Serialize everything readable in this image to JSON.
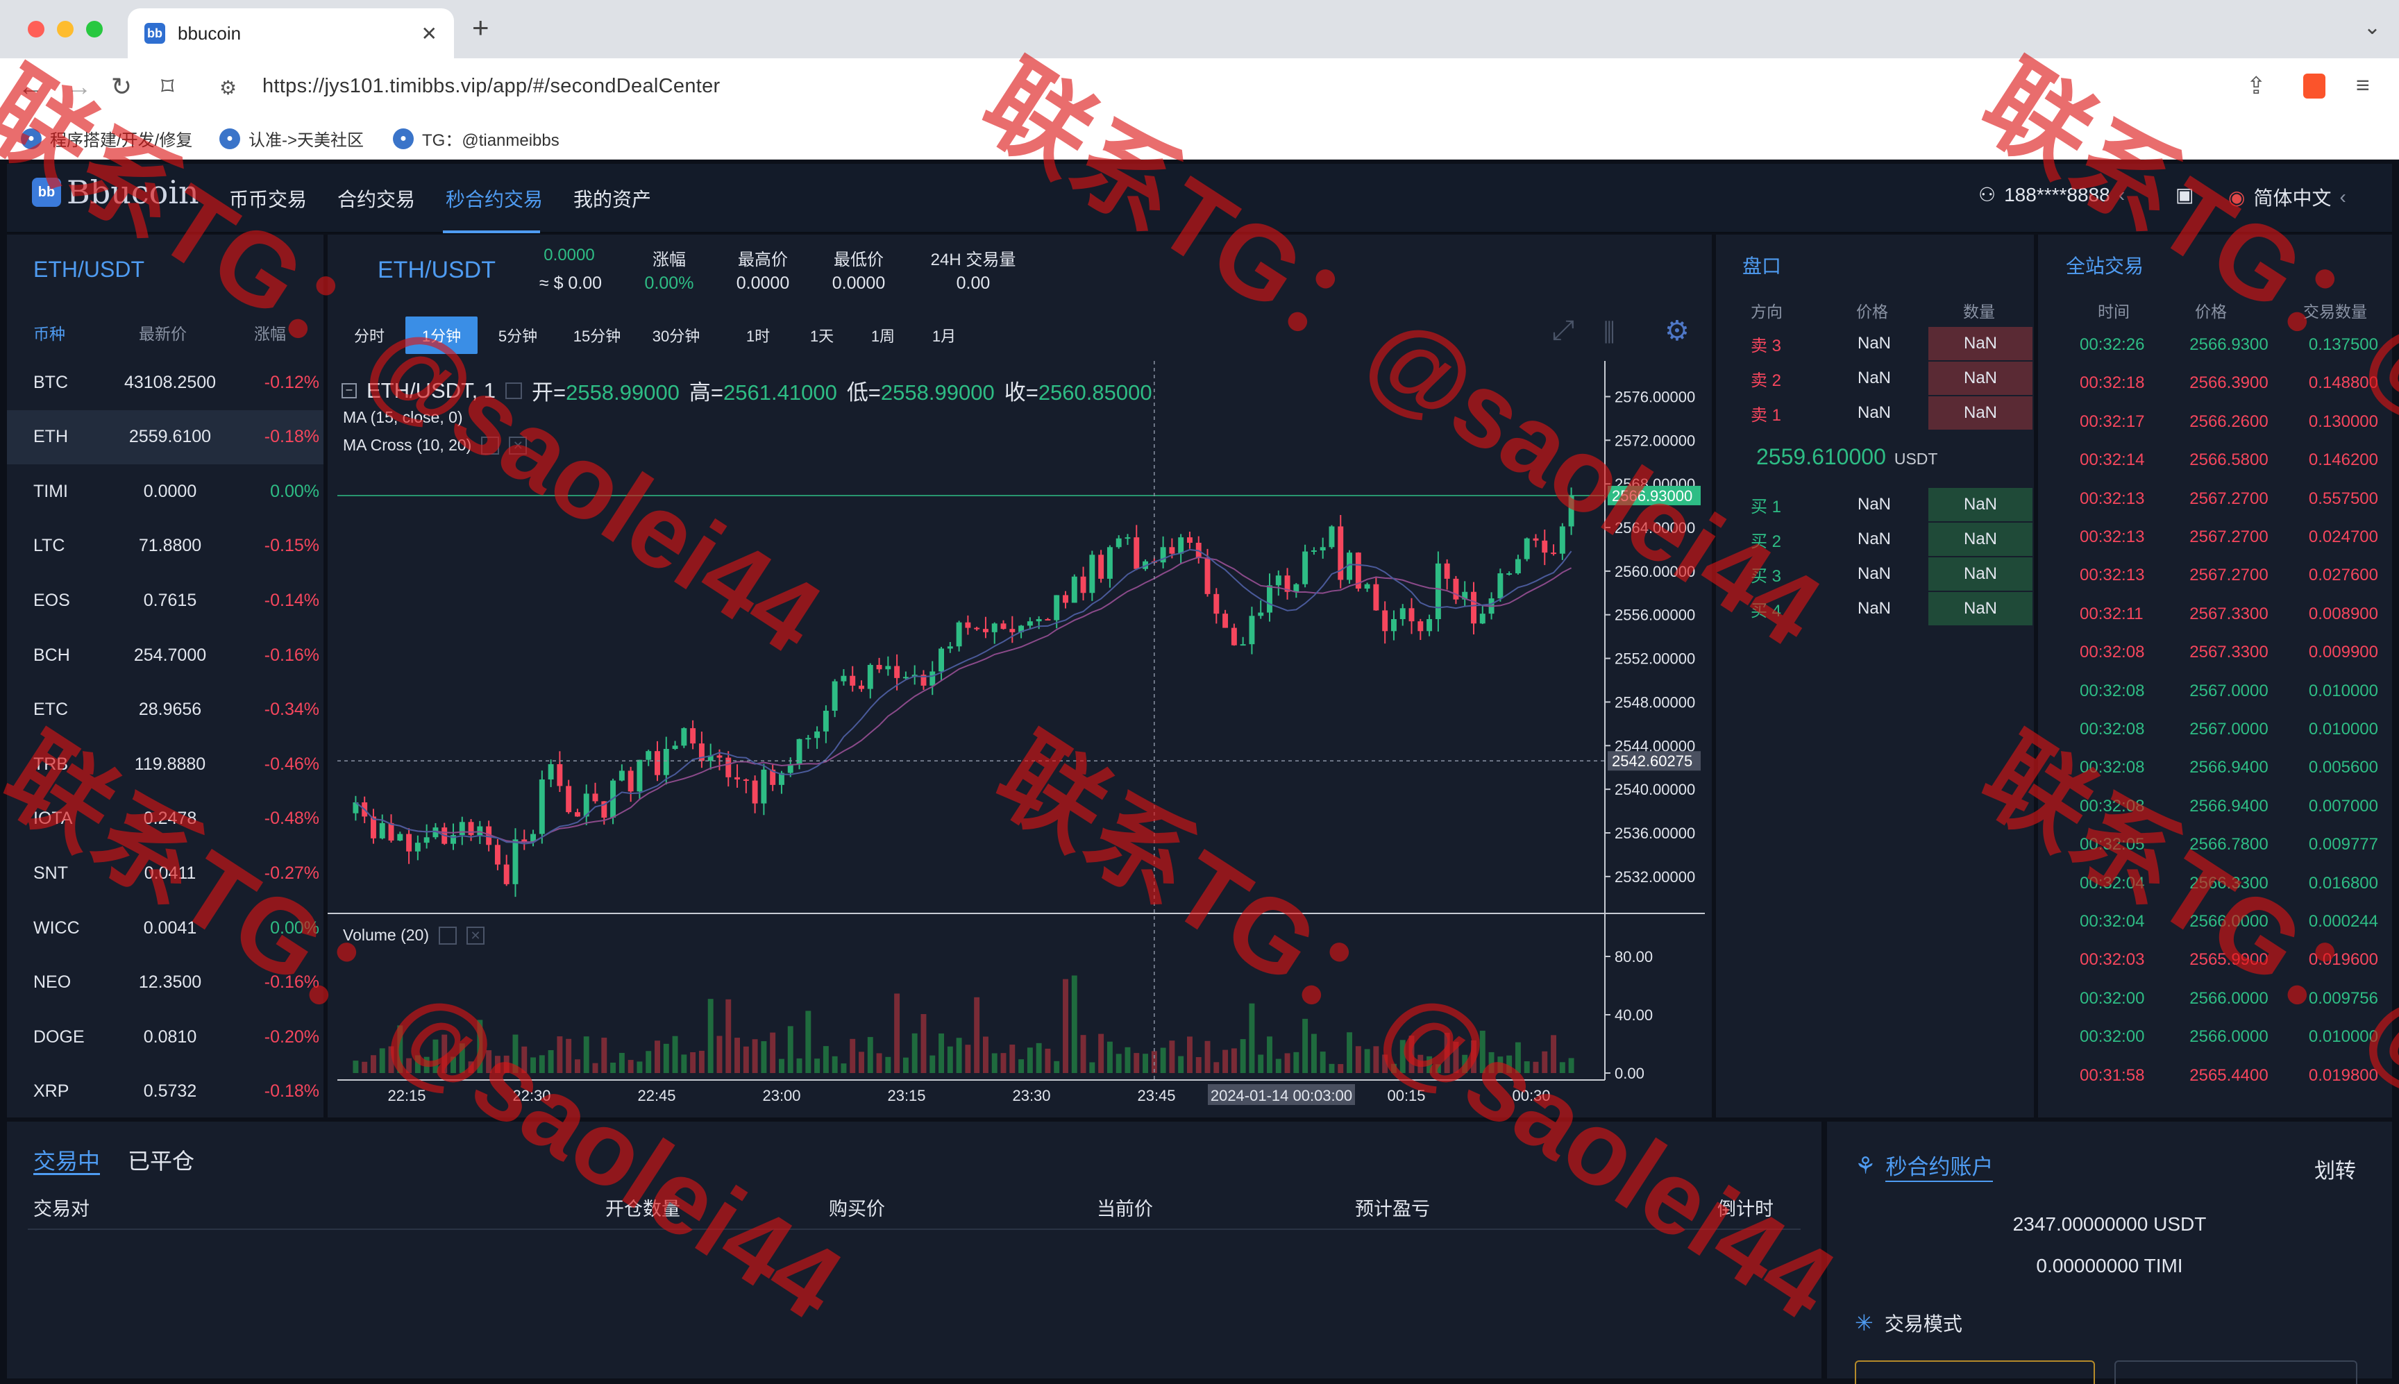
{
  "browser": {
    "tab_title": "bbucoin",
    "tab_favicon": "bb",
    "new_tab": "+",
    "url": "https://jys101.timibbs.vip/app/#/secondDealCenter",
    "bookmarks": [
      {
        "label": "程序搭建/开发/修复"
      },
      {
        "label": "认准->天美社区"
      },
      {
        "label": "TG：@tianmeibbs"
      }
    ]
  },
  "app": {
    "logo_text": "Bbucoin",
    "logo_mark": "bb",
    "nav": [
      {
        "label": "币币交易",
        "active": false
      },
      {
        "label": "合约交易",
        "active": false
      },
      {
        "label": "秒合约交易",
        "active": true
      },
      {
        "label": "我的资产",
        "active": false
      }
    ],
    "user": "188****8888",
    "language": "简体中文"
  },
  "market": {
    "pair": "ETH/USDT",
    "headers": {
      "symbol": "币种",
      "price": "最新价",
      "change": "涨幅"
    },
    "rows": [
      {
        "symbol": "BTC",
        "price": "43108.2500",
        "change": "-0.12%",
        "dir": "down"
      },
      {
        "symbol": "ETH",
        "price": "2559.6100",
        "change": "-0.18%",
        "dir": "down",
        "selected": true
      },
      {
        "symbol": "TIMI",
        "price": "0.0000",
        "change": "0.00%",
        "dir": "up"
      },
      {
        "symbol": "LTC",
        "price": "71.8800",
        "change": "-0.15%",
        "dir": "down"
      },
      {
        "symbol": "EOS",
        "price": "0.7615",
        "change": "-0.14%",
        "dir": "down"
      },
      {
        "symbol": "BCH",
        "price": "254.7000",
        "change": "-0.16%",
        "dir": "down"
      },
      {
        "symbol": "ETC",
        "price": "28.9656",
        "change": "-0.34%",
        "dir": "down"
      },
      {
        "symbol": "TRB",
        "price": "119.8880",
        "change": "-0.46%",
        "dir": "down"
      },
      {
        "symbol": "IOTA",
        "price": "0.2478",
        "change": "-0.48%",
        "dir": "down"
      },
      {
        "symbol": "SNT",
        "price": "0.0411",
        "change": "-0.27%",
        "dir": "down"
      },
      {
        "symbol": "WICC",
        "price": "0.0041",
        "change": "0.00%",
        "dir": "up"
      },
      {
        "symbol": "NEO",
        "price": "12.3500",
        "change": "-0.16%",
        "dir": "down"
      },
      {
        "symbol": "DOGE",
        "price": "0.0810",
        "change": "-0.20%",
        "dir": "down"
      },
      {
        "symbol": "XRP",
        "price": "0.5732",
        "change": "-0.18%",
        "dir": "down"
      }
    ]
  },
  "chart_header": {
    "pair": "ETH/USDT",
    "last_price": "0.0000",
    "last_price_usd": "≈ $ 0.00",
    "stats": [
      {
        "label": "涨幅",
        "value": "0.00%",
        "color": "#2ebd85"
      },
      {
        "label": "最高价",
        "value": "0.0000",
        "color": "#e2e6ee"
      },
      {
        "label": "最低价",
        "value": "0.0000",
        "color": "#e2e6ee"
      },
      {
        "label": "24H 交易量",
        "value": "0.00",
        "color": "#e2e6ee"
      }
    ],
    "timeframes": [
      "分时",
      "1分钟",
      "5分钟",
      "15分钟",
      "30分钟",
      "1时",
      "1天",
      "1周",
      "1月"
    ],
    "active_timeframe": "1分钟"
  },
  "chart_data": {
    "type": "candlestick",
    "symbol_label": "ETH/USDT, 1",
    "ohlc_labels": {
      "open": "开=",
      "high": "高=",
      "low": "低=",
      "close": "收="
    },
    "ohlc": {
      "open": "2558.99000",
      "high": "2561.41000",
      "low": "2558.99000",
      "close": "2560.85000"
    },
    "indicators": [
      "MA (15, close, 0)",
      "MA Cross (10, 20)"
    ],
    "volume_label": "Volume (20)",
    "price_ticks": [
      "2576.00000",
      "2572.00000",
      "2568.00000",
      "2564.00000",
      "2560.00000",
      "2556.00000",
      "2552.00000",
      "2548.00000",
      "2544.00000",
      "2540.00000",
      "2536.00000",
      "2532.00000"
    ],
    "price_range": [
      2529,
      2578
    ],
    "current_price_label": "2566.93000",
    "current_price": 2566.93,
    "crosshair_price_label": "2542.60275",
    "crosshair_price": 2542.60275,
    "volume_ticks": [
      "80.00",
      "40.00",
      "0.00"
    ],
    "volume_range": [
      0,
      100
    ],
    "time_ticks": [
      "22:15",
      "22:30",
      "22:45",
      "23:00",
      "23:15",
      "23:30",
      "23:45",
      "2024-01-14 00:03:00",
      "00:15",
      "00:30"
    ],
    "closes": [
      2538.8,
      2537.5,
      2535.5,
      2536.9,
      2535.3,
      2535.9,
      2534.3,
      2535.1,
      2535.6,
      2536.5,
      2535.0,
      2535.8,
      2537.0,
      2535.8,
      2536.6,
      2534.9,
      2533.1,
      2531.3,
      2535.4,
      2535.2,
      2535.9,
      2540.9,
      2542.3,
      2540.3,
      2537.9,
      2537.5,
      2539.6,
      2538.9,
      2537.4,
      2540.8,
      2541.7,
      2539.8,
      2542.7,
      2543.5,
      2541.3,
      2543.7,
      2544.0,
      2545.6,
      2544.2,
      2542.6,
      2543.1,
      2542.9,
      2541.1,
      2540.9,
      2540.8,
      2538.7,
      2541.8,
      2540.4,
      2541.5,
      2542.3,
      2544.6,
      2544.7,
      2545.3,
      2547.2,
      2549.9,
      2550.4,
      2549.5,
      2549.2,
      2551.4,
      2551.0,
      2551.3,
      2550.2,
      2550.3,
      2550.5,
      2549.5,
      2550.8,
      2552.9,
      2553.1,
      2555.3,
      2554.8,
      2554.7,
      2554.4,
      2555.2,
      2554.7,
      2554.4,
      2555.0,
      2555.4,
      2555.6,
      2555.5,
      2557.8,
      2557.1,
      2559.5,
      2558.0,
      2561.5,
      2559.3,
      2562.2,
      2563.0,
      2563.1,
      2560.2,
      2560.9,
      2560.8,
      2562.2,
      2561.6,
      2563.1,
      2562.6,
      2561.2,
      2557.9,
      2556.1,
      2554.8,
      2553.2,
      2553.3,
      2555.9,
      2556.2,
      2558.7,
      2559.6,
      2558.1,
      2558.8,
      2561.8,
      2561.9,
      2562.2,
      2564.1,
      2559.2,
      2561.7,
      2558.4,
      2558.8,
      2556.4,
      2554.5,
      2555.6,
      2556.6,
      2555.4,
      2554.5,
      2555.6,
      2560.7,
      2559.3,
      2557.4,
      2558.1,
      2555.2,
      2556.1,
      2557.5,
      2559.8,
      2559.8,
      2561.1,
      2563.0,
      2562.8,
      2561.7,
      2561.6,
      2564.1,
      2566.9
    ]
  },
  "order_book": {
    "title": "盘口",
    "headers": {
      "side": "方向",
      "price": "价格",
      "qty": "数量"
    },
    "asks": [
      {
        "side": "卖 3",
        "price": "NaN",
        "qty": "NaN"
      },
      {
        "side": "卖 2",
        "price": "NaN",
        "qty": "NaN"
      },
      {
        "side": "卖 1",
        "price": "NaN",
        "qty": "NaN"
      }
    ],
    "mid_price": "2559.610000",
    "mid_unit": "USDT",
    "bids": [
      {
        "side": "买 1",
        "price": "NaN",
        "qty": "NaN"
      },
      {
        "side": "买 2",
        "price": "NaN",
        "qty": "NaN"
      },
      {
        "side": "买 3",
        "price": "NaN",
        "qty": "NaN"
      },
      {
        "side": "买 4",
        "price": "NaN",
        "qty": "NaN"
      }
    ]
  },
  "trades": {
    "title": "全站交易",
    "headers": {
      "time": "时间",
      "price": "价格",
      "qty": "交易数量"
    },
    "rows": [
      {
        "time": "00:32:26",
        "price": "2566.9300",
        "qty": "0.137500",
        "dir": "up"
      },
      {
        "time": "00:32:18",
        "price": "2566.3900",
        "qty": "0.148800",
        "dir": "down"
      },
      {
        "time": "00:32:17",
        "price": "2566.2600",
        "qty": "0.130000",
        "dir": "down"
      },
      {
        "time": "00:32:14",
        "price": "2566.5800",
        "qty": "0.146200",
        "dir": "down"
      },
      {
        "time": "00:32:13",
        "price": "2567.2700",
        "qty": "0.557500",
        "dir": "down"
      },
      {
        "time": "00:32:13",
        "price": "2567.2700",
        "qty": "0.024700",
        "dir": "down"
      },
      {
        "time": "00:32:13",
        "price": "2567.2700",
        "qty": "0.027600",
        "dir": "down"
      },
      {
        "time": "00:32:11",
        "price": "2567.3300",
        "qty": "0.008900",
        "dir": "down"
      },
      {
        "time": "00:32:08",
        "price": "2567.3300",
        "qty": "0.009900",
        "dir": "down"
      },
      {
        "time": "00:32:08",
        "price": "2567.0000",
        "qty": "0.010000",
        "dir": "up"
      },
      {
        "time": "00:32:08",
        "price": "2567.0000",
        "qty": "0.010000",
        "dir": "up"
      },
      {
        "time": "00:32:08",
        "price": "2566.9400",
        "qty": "0.005600",
        "dir": "up"
      },
      {
        "time": "00:32:08",
        "price": "2566.9400",
        "qty": "0.007000",
        "dir": "up"
      },
      {
        "time": "00:32:05",
        "price": "2566.7800",
        "qty": "0.009777",
        "dir": "up"
      },
      {
        "time": "00:32:04",
        "price": "2566.3300",
        "qty": "0.016800",
        "dir": "up"
      },
      {
        "time": "00:32:04",
        "price": "2566.0000",
        "qty": "0.000244",
        "dir": "up"
      },
      {
        "time": "00:32:03",
        "price": "2565.9900",
        "qty": "0.019600",
        "dir": "down"
      },
      {
        "time": "00:32:00",
        "price": "2566.0000",
        "qty": "0.009756",
        "dir": "up"
      },
      {
        "time": "00:32:00",
        "price": "2566.0000",
        "qty": "0.010000",
        "dir": "up"
      },
      {
        "time": "00:31:58",
        "price": "2565.4400",
        "qty": "0.019800",
        "dir": "down"
      }
    ]
  },
  "positions": {
    "tabs": [
      {
        "label": "交易中",
        "active": true
      },
      {
        "label": "已平仓",
        "active": false
      }
    ],
    "headers": [
      "交易对",
      "开仓数量",
      "购买价",
      "当前价",
      "预计盈亏",
      "倒计时"
    ]
  },
  "account": {
    "title": "秒合约账户",
    "transfer": "划转",
    "balance_usdt": "2347.00000000 USDT",
    "balance_timi": "0.00000000 TIMI",
    "mode_label": "交易模式"
  },
  "watermark_text": "联系TG：@saolei44",
  "colors": {
    "up": "#2ebd85",
    "down": "#f6465d",
    "accent": "#4f9cf2",
    "bg": "#101521",
    "panel": "#161d2b"
  }
}
